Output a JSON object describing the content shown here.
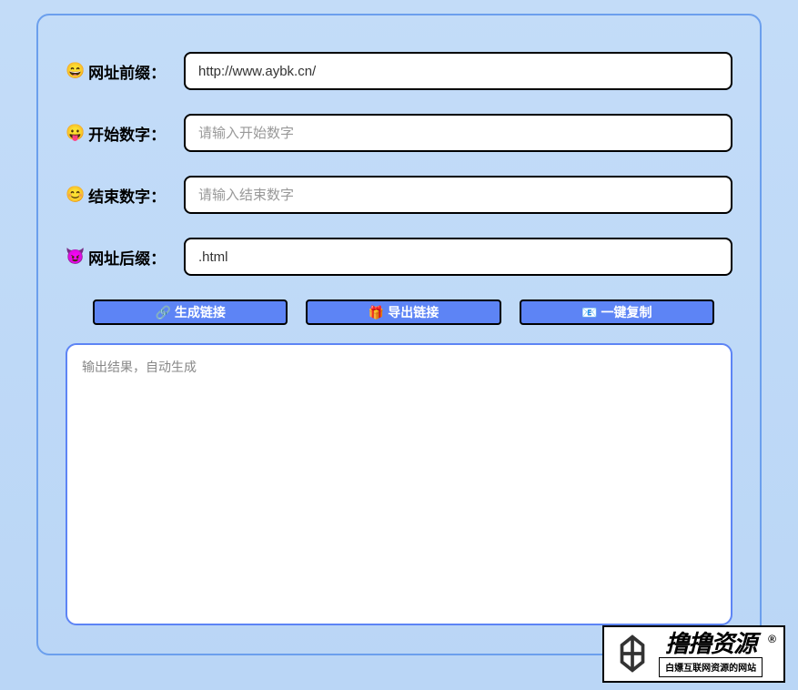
{
  "form": {
    "urlPrefix": {
      "icon": "😄",
      "label": "网址前缀：",
      "value": "http://www.aybk.cn/",
      "placeholder": ""
    },
    "startNumber": {
      "icon": "😛",
      "label": "开始数字：",
      "value": "",
      "placeholder": "请输入开始数字"
    },
    "endNumber": {
      "icon": "😊",
      "label": "结束数字：",
      "value": "",
      "placeholder": "请输入结束数字"
    },
    "urlSuffix": {
      "icon": "😈",
      "label": "网址后缀：",
      "value": ".html",
      "placeholder": ""
    }
  },
  "buttons": {
    "generate": {
      "icon": "🔗",
      "label": "生成链接"
    },
    "export": {
      "icon": "🎁",
      "label": "导出链接"
    },
    "copy": {
      "icon": "📧",
      "label": "一键复制"
    }
  },
  "output": {
    "placeholder": "输出结果，自动生成"
  },
  "watermark": {
    "main": "撸撸资源",
    "sub": "白嫖互联网资源的网站",
    "symbol": "®"
  }
}
